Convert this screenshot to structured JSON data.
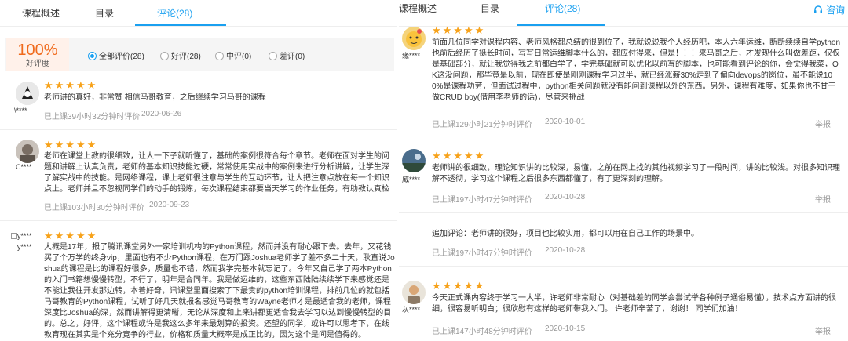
{
  "left_panel": {
    "tabs": [
      "课程概述",
      "目录",
      "评论(28)"
    ],
    "summary": {
      "score": "100%",
      "score_label": "好评度",
      "filters": [
        {
          "label": "全部评价(28)",
          "selected": true
        },
        {
          "label": "好评(28)",
          "selected": false
        },
        {
          "label": "中评(0)",
          "selected": false
        },
        {
          "label": "差评(0)",
          "selected": false
        }
      ]
    },
    "reviews": [
      {
        "user": "\\****",
        "text": "老师讲的真好，非常赞 相信马哥教育，之后继续学习马哥的课程",
        "learned": "已上课39小时32分钟时评价",
        "date": "2020-06-26"
      },
      {
        "user": "C****",
        "text": "老师在课堂上教的很细致，让人一下子就听懂了，基础的案例很符合每个章节。老师在面对学生的问题和讲解上认真负责，老师的基本知识技能过硬，常常使用实战中的案例来进行分析讲解，让学生深了解实战中的技能。是网络课程，课上老师很注意与学生的互动环节，让人把注意点放在每一个知识点上。老师并且不忽视同学们的动手的锻炼，每次课程结束都要当天学习的作业任务，有助教认真检查和批阅，很负责任。在这里我学到很多技",
        "learned": "已上课103小时30分钟时评价",
        "date": "2020-09-23"
      },
      {
        "user": "y****",
        "avatar_alt": "y****",
        "text": "大概是17年，报了腾讯课堂另外一家培训机构的Python课程，然而并没有耐心跟下去。去年，又花钱买了个万学的终身vip，里面也有不少Python课程，在万门跟Joshua老师学了差不多二十天，耿直说Joshua的课程是比的课程好很多，质量也不错，然而我学完基本就忘记了。今年又自己学了两本Python的入门书籍想慢慢转型，不行了，明年是合同年。我是做运维的，这些东西陆陆续续学下来感觉还是不能让我往开发那边转，本着好奇，讯课堂里面搜索了下最贵的python培训课程，排前几位的就包括马哥教育的Python课程，试听了好几天就报名感觉马哥教育的Wayne老师才是最适合我的老师，课程深度比Joshua的深，然而讲解得更清晰，无论从深度和上来讲都更适合我去学习以达到慢慢转型的目的。总之，好评，这个课程或许是我这么多年来最划算的投资。还望的同学，或许可以思考下，在线教育现在其实是个充分竞争的行业，价格和质量大概率是成正比的，因为这个是间是值得的。"
      }
    ]
  },
  "right_panel": {
    "tabs": [
      "课程概述",
      "目录",
      "评论(28)"
    ],
    "consult": "咨询",
    "reviews": [
      {
        "user": "缘****",
        "text": "前面几位同学对课程内容、老师风格都总结的很到位了，我就说说我个人经历吧，本人六年运维，断断续续自学python也前后经历了挺长时间，写写日常运维脚本什么的，都应付得来，但是！！！来马哥之后，才发现什么叫做差距，仅仅是基础部分，就让我觉得我之前都白学了，学完基础就可以优化以前写的脚本，也可能看到评论的你，会觉得我菜，OK这没问题，那毕竟是以前，现在即使是刚刚课程学习过半，就已经涨薪30%走到了偏向devops的岗位，虽不能说100%是课程功劳，但面试过程中，python相关问题就没有能问到课程以外的东西。另外，课程有难度，如果你也不甘于做CRUD boy(借用李老师的话)，尽管来挑战",
        "learned": "已上课129小时21分钟时评价",
        "date": "2020-10-01",
        "report": "举报"
      },
      {
        "user": "威****",
        "text": "老师讲的很细致，理论知识讲的比较深，易懂，之前在网上找的其他视频学习了一段时间，讲的比较浅。对很多知识理解不透彻，学习这个课程之后很多东西都懂了，有了更深刻的理解。",
        "learned": "已上课197小时47分钟时评价",
        "date": "2020-10-28",
        "report": "举报"
      },
      {
        "followup": true,
        "text": "追加评论：老师讲的很好，项目也比较实用，都可以用在自己工作的场景中。",
        "learned": "已上课197小时47分钟时评价",
        "date": "2020-10-28"
      },
      {
        "user": "灰****",
        "text": "今天正式课内容终于学习一大半，许老师非常耐心（对基础差的同学会尝试举各种例子通俗易懂），技术点方面讲的很细，很容易听明白；很欣慰有这样的老师带我入门。 许老师辛苦了，谢谢！ 同学们加油！",
        "learned": "已上课147小时48分钟时评价",
        "date": "2020-10-15",
        "report": "举报"
      }
    ]
  },
  "colors": {
    "accent": "#1aa0f0",
    "score": "#f06a1c",
    "stars": "#f7a21a",
    "muted": "#999999"
  },
  "icons": {
    "rating": "star-icon",
    "consult": "headset-icon",
    "radio": "radio-icon"
  }
}
